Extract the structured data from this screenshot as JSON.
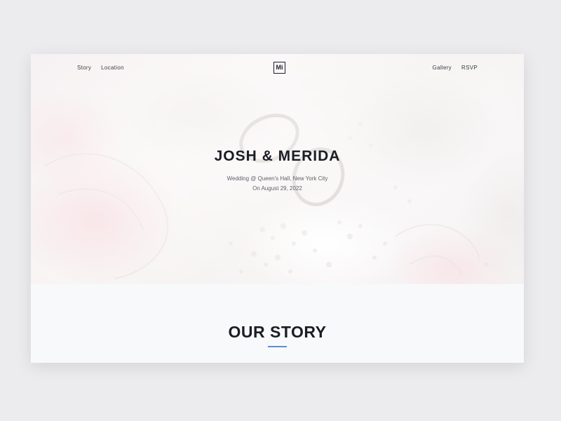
{
  "nav": {
    "left": [
      "Story",
      "Location"
    ],
    "right": [
      "Gallery",
      "RSVP"
    ],
    "logo": "Mi"
  },
  "hero": {
    "title": "JOSH & MERIDA",
    "subtitle_line1": "Wedding @ Queen's Hall, New York City",
    "subtitle_line2": "On August 29, 2022",
    "image": "wedding-rings-and-flowers-photo"
  },
  "story": {
    "title": "OUR STORY"
  },
  "colors": {
    "background": "#ececee",
    "page": "#f8f9fb",
    "text_dark": "#1b1d24",
    "accent": "#5a8ed8"
  }
}
